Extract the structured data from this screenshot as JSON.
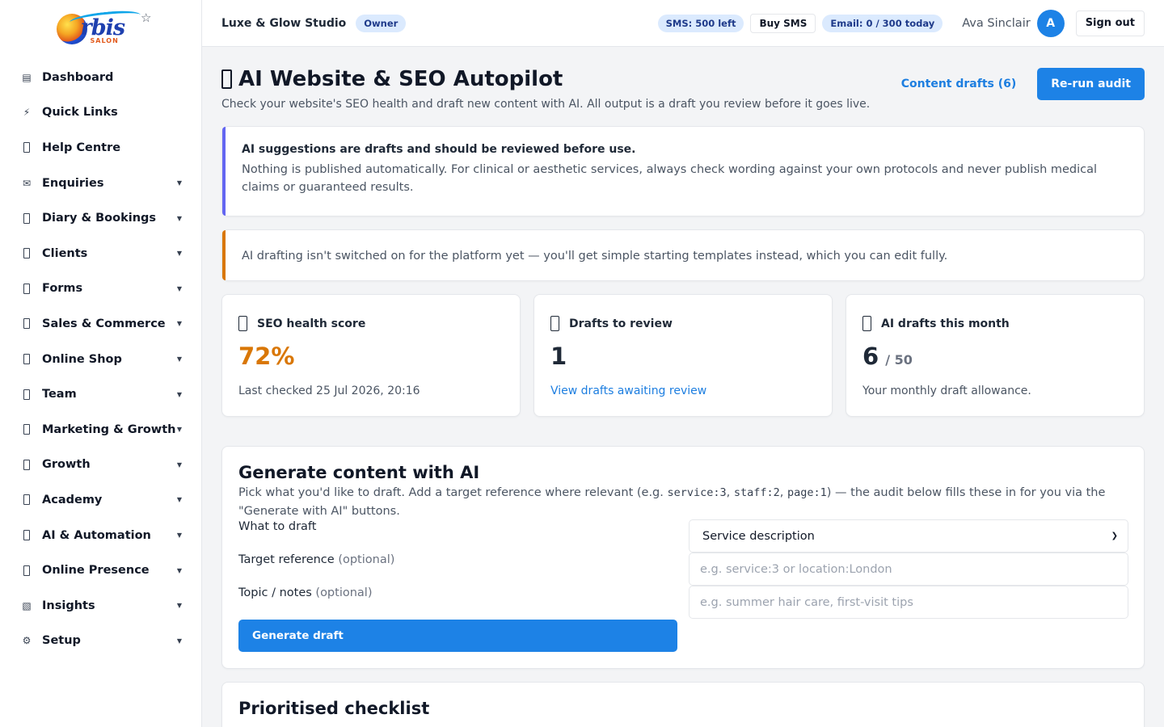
{
  "brand": {
    "logo_text": "rbis",
    "logo_sub": "SALON"
  },
  "sidebar": {
    "items": [
      {
        "label": "Dashboard",
        "icon": "list-icon",
        "glyph": "▤",
        "caret": false
      },
      {
        "label": "Quick Links",
        "icon": "bolt-icon",
        "glyph": "⚡",
        "caret": false
      },
      {
        "label": "Help Centre",
        "icon": "help-icon",
        "glyph": "",
        "caret": false
      },
      {
        "label": "Enquiries",
        "icon": "mail-icon",
        "glyph": "✉",
        "caret": true
      },
      {
        "label": "Diary & Bookings",
        "icon": "calendar-icon",
        "glyph": "",
        "caret": true
      },
      {
        "label": "Clients",
        "icon": "clients-icon",
        "glyph": "",
        "caret": true
      },
      {
        "label": "Forms",
        "icon": "forms-icon",
        "glyph": "",
        "caret": true
      },
      {
        "label": "Sales & Commerce",
        "icon": "sales-icon",
        "glyph": "",
        "caret": true
      },
      {
        "label": "Online Shop",
        "icon": "shop-icon",
        "glyph": "",
        "caret": true
      },
      {
        "label": "Team",
        "icon": "team-icon",
        "glyph": "",
        "caret": true
      },
      {
        "label": "Marketing & Growth",
        "icon": "marketing-icon",
        "glyph": "",
        "caret": true
      },
      {
        "label": "Growth",
        "icon": "growth-icon",
        "glyph": "",
        "caret": true
      },
      {
        "label": "Academy",
        "icon": "academy-icon",
        "glyph": "",
        "caret": true
      },
      {
        "label": "AI & Automation",
        "icon": "ai-icon",
        "glyph": "",
        "caret": true
      },
      {
        "label": "Online Presence",
        "icon": "globe-icon",
        "glyph": "",
        "caret": true
      },
      {
        "label": "Insights",
        "icon": "chart-icon",
        "glyph": "▧",
        "caret": true
      },
      {
        "label": "Setup",
        "icon": "gear-icon",
        "glyph": "⚙",
        "caret": true
      }
    ]
  },
  "topbar": {
    "studio_name": "Luxe & Glow Studio",
    "role_badge": "Owner",
    "sms_badge": "SMS: 500 left",
    "buy_sms": "Buy SMS",
    "email_badge": "Email: 0 / 300 today",
    "user_name": "Ava Sinclair",
    "avatar_initial": "A",
    "sign_out": "Sign out"
  },
  "page": {
    "title": "AI Website & SEO Autopilot",
    "subtitle": "Check your website's SEO health and draft new content with AI. All output is a draft you review before it goes live.",
    "content_drafts_link": "Content drafts (6)",
    "rerun_button": "Re-run audit"
  },
  "notices": {
    "review_title": "AI suggestions are drafts and should be reviewed before use.",
    "review_body": "Nothing is published automatically. For clinical or aesthetic services, always check wording against your own protocols and never publish medical claims or guaranteed results.",
    "fallback_body": "AI drafting isn't switched on for the platform yet — you'll get simple starting templates instead, which you can edit fully."
  },
  "stats": {
    "seo": {
      "title": "SEO health score",
      "value": "72%",
      "foot": "Last checked 25 Jul 2026, 20:16"
    },
    "drafts": {
      "title": "Drafts to review",
      "value": "1",
      "link": "View drafts awaiting review"
    },
    "monthly": {
      "title": "AI drafts this month",
      "value": "6",
      "denom": "/ 50",
      "foot": "Your monthly draft allowance."
    }
  },
  "generate": {
    "title": "Generate content with AI",
    "desc_1": "Pick what you'd like to draft. Add a target reference where relevant (e.g. ",
    "code_1": "service:3",
    "sep_1": ", ",
    "code_2": "staff:2",
    "sep_2": ", ",
    "code_3": "page:1",
    "desc_2": ") — the audit below fills these in for you via the \"Generate with AI\" buttons.",
    "what_label": "What to draft",
    "what_value": "Service description",
    "target_label": "Target reference",
    "target_optional": "(optional)",
    "target_placeholder": "e.g. service:3 or location:London",
    "topic_label": "Topic / notes",
    "topic_optional": "(optional)",
    "topic_placeholder": "e.g. summer hair care, first-visit tips",
    "button": "Generate draft"
  },
  "checklist": {
    "title": "Prioritised checklist"
  },
  "colors": {
    "accent": "#1d82e6",
    "score": "#d97706",
    "notice_purple": "#6366f1",
    "notice_orange": "#d97706"
  }
}
